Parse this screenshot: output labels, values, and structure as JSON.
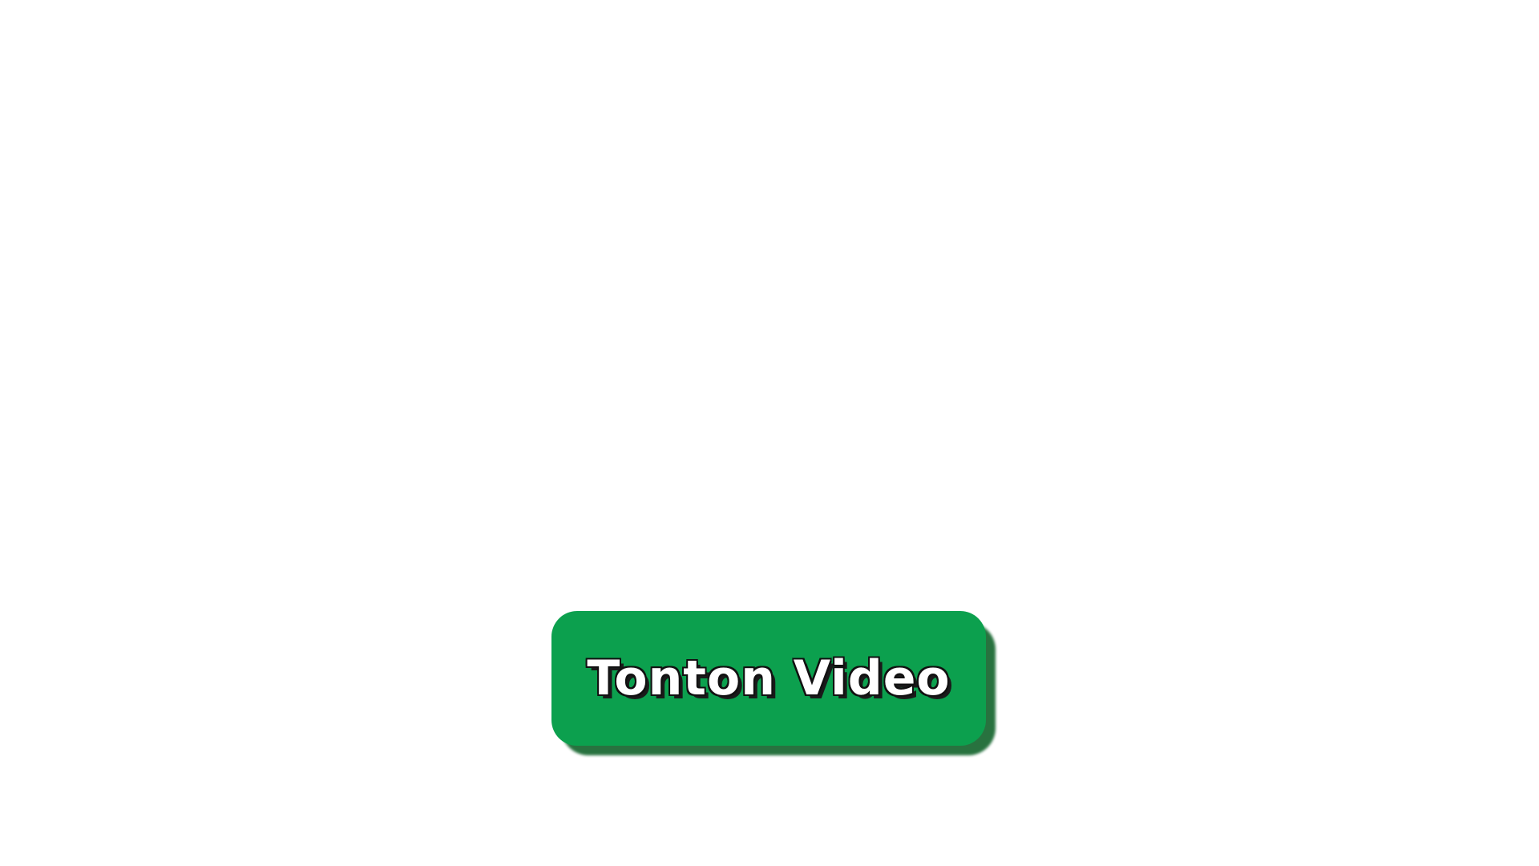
{
  "cta": {
    "label": "Tonton Video",
    "color": "#0ca04e",
    "shadow_color": "#1d6b35",
    "text_color": "#ffffff"
  }
}
